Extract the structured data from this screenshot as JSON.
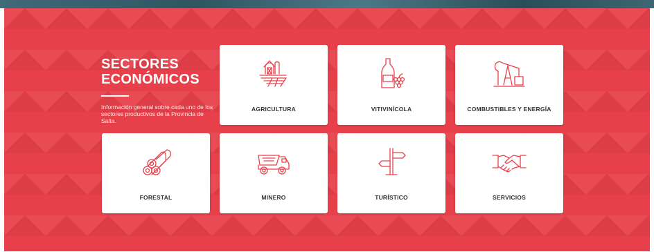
{
  "intro": {
    "title": "SECTORES\nECONÓMICOS",
    "description": "Información general sobre cada uno de los sectores productivos de la Provincia de Salta."
  },
  "colors": {
    "accent": "#e8404a",
    "card_background": "#ffffff",
    "label_text": "#333333"
  },
  "sectors": [
    {
      "label": "AGRICULTURA",
      "icon": "barn-icon"
    },
    {
      "label": "VITIVINÍCOLA",
      "icon": "wine-grapes-icon"
    },
    {
      "label": "COMBUSTIBLES Y ENERGÍA",
      "icon": "oil-pump-icon"
    },
    {
      "label": "FORESTAL",
      "icon": "logs-icon"
    },
    {
      "label": "MINERO",
      "icon": "mining-truck-icon"
    },
    {
      "label": "TURÍSTICO",
      "icon": "signpost-icon"
    },
    {
      "label": "SERVICIOS",
      "icon": "handshake-icon"
    }
  ]
}
